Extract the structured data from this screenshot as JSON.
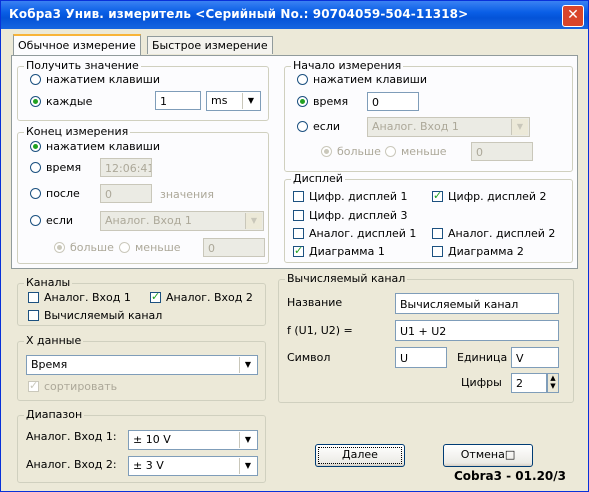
{
  "window": {
    "title": "Кобра3 Унив. измеритель  <Серийный No.: 90704059-504-11318>",
    "close_glyph": "✕"
  },
  "tabs": [
    {
      "label": "Обычное измерение"
    },
    {
      "label": "Быстрое измерение"
    }
  ],
  "get_value": {
    "legend": "Получить значение",
    "by_key": "нажатием клавиши",
    "every": "каждые",
    "every_value": "1",
    "unit": "ms"
  },
  "end_measure": {
    "legend": "Конец измерения",
    "by_key": "нажатием клавиши",
    "time": "время",
    "time_value": "12:06:41",
    "after": "после",
    "after_value": "0",
    "after_suffix": "значения",
    "if": "если",
    "if_source": "Аналог. Вход 1",
    "greater": "больше",
    "less": "меньше",
    "threshold": "0"
  },
  "start_measure": {
    "legend": "Начало измерения",
    "by_key": "нажатием клавиши",
    "time": "время",
    "time_value": "0",
    "if": "если",
    "if_source": "Аналог. Вход 1",
    "greater": "больше",
    "less": "меньше",
    "threshold": "0"
  },
  "displays": {
    "legend": "Дисплей",
    "d1": "Цифр. дисплей 1",
    "d2": "Цифр. дисплей 2",
    "d3": "Цифр. дисплей 3",
    "a1": "Аналог. дисплей 1",
    "a2": "Аналог. дисплей 2",
    "g1": "Диаграмма 1",
    "g2": "Диаграмма 2"
  },
  "channels": {
    "legend": "Каналы",
    "in1": "Аналог. Вход 1",
    "in2": "Аналог. Вход 2",
    "calc": "Вычисляемый канал"
  },
  "xdata": {
    "legend": "X данные",
    "value": "Время",
    "sort": "сортировать"
  },
  "range": {
    "legend": "Диапазон",
    "in1_label": "Аналог. Вход 1:",
    "in1_value": "± 10 V",
    "in2_label": "Аналог. Вход 2:",
    "in2_value": "± 3 V"
  },
  "calc_channel": {
    "legend": "Вычисляемый канал",
    "name_label": "Название",
    "name_value": "Вычисляемый канал",
    "formula_label": "f (U1, U2) =",
    "formula_value": "U1 + U2",
    "symbol_label": "Символ",
    "symbol_value": "U",
    "unit_label": "Единица",
    "unit_value": "V",
    "digits_label": "Цифры",
    "digits_value": "2"
  },
  "buttons": {
    "next": "Далее",
    "cancel": "Отмена□"
  },
  "status": "Cobra3 - 01.20/3"
}
